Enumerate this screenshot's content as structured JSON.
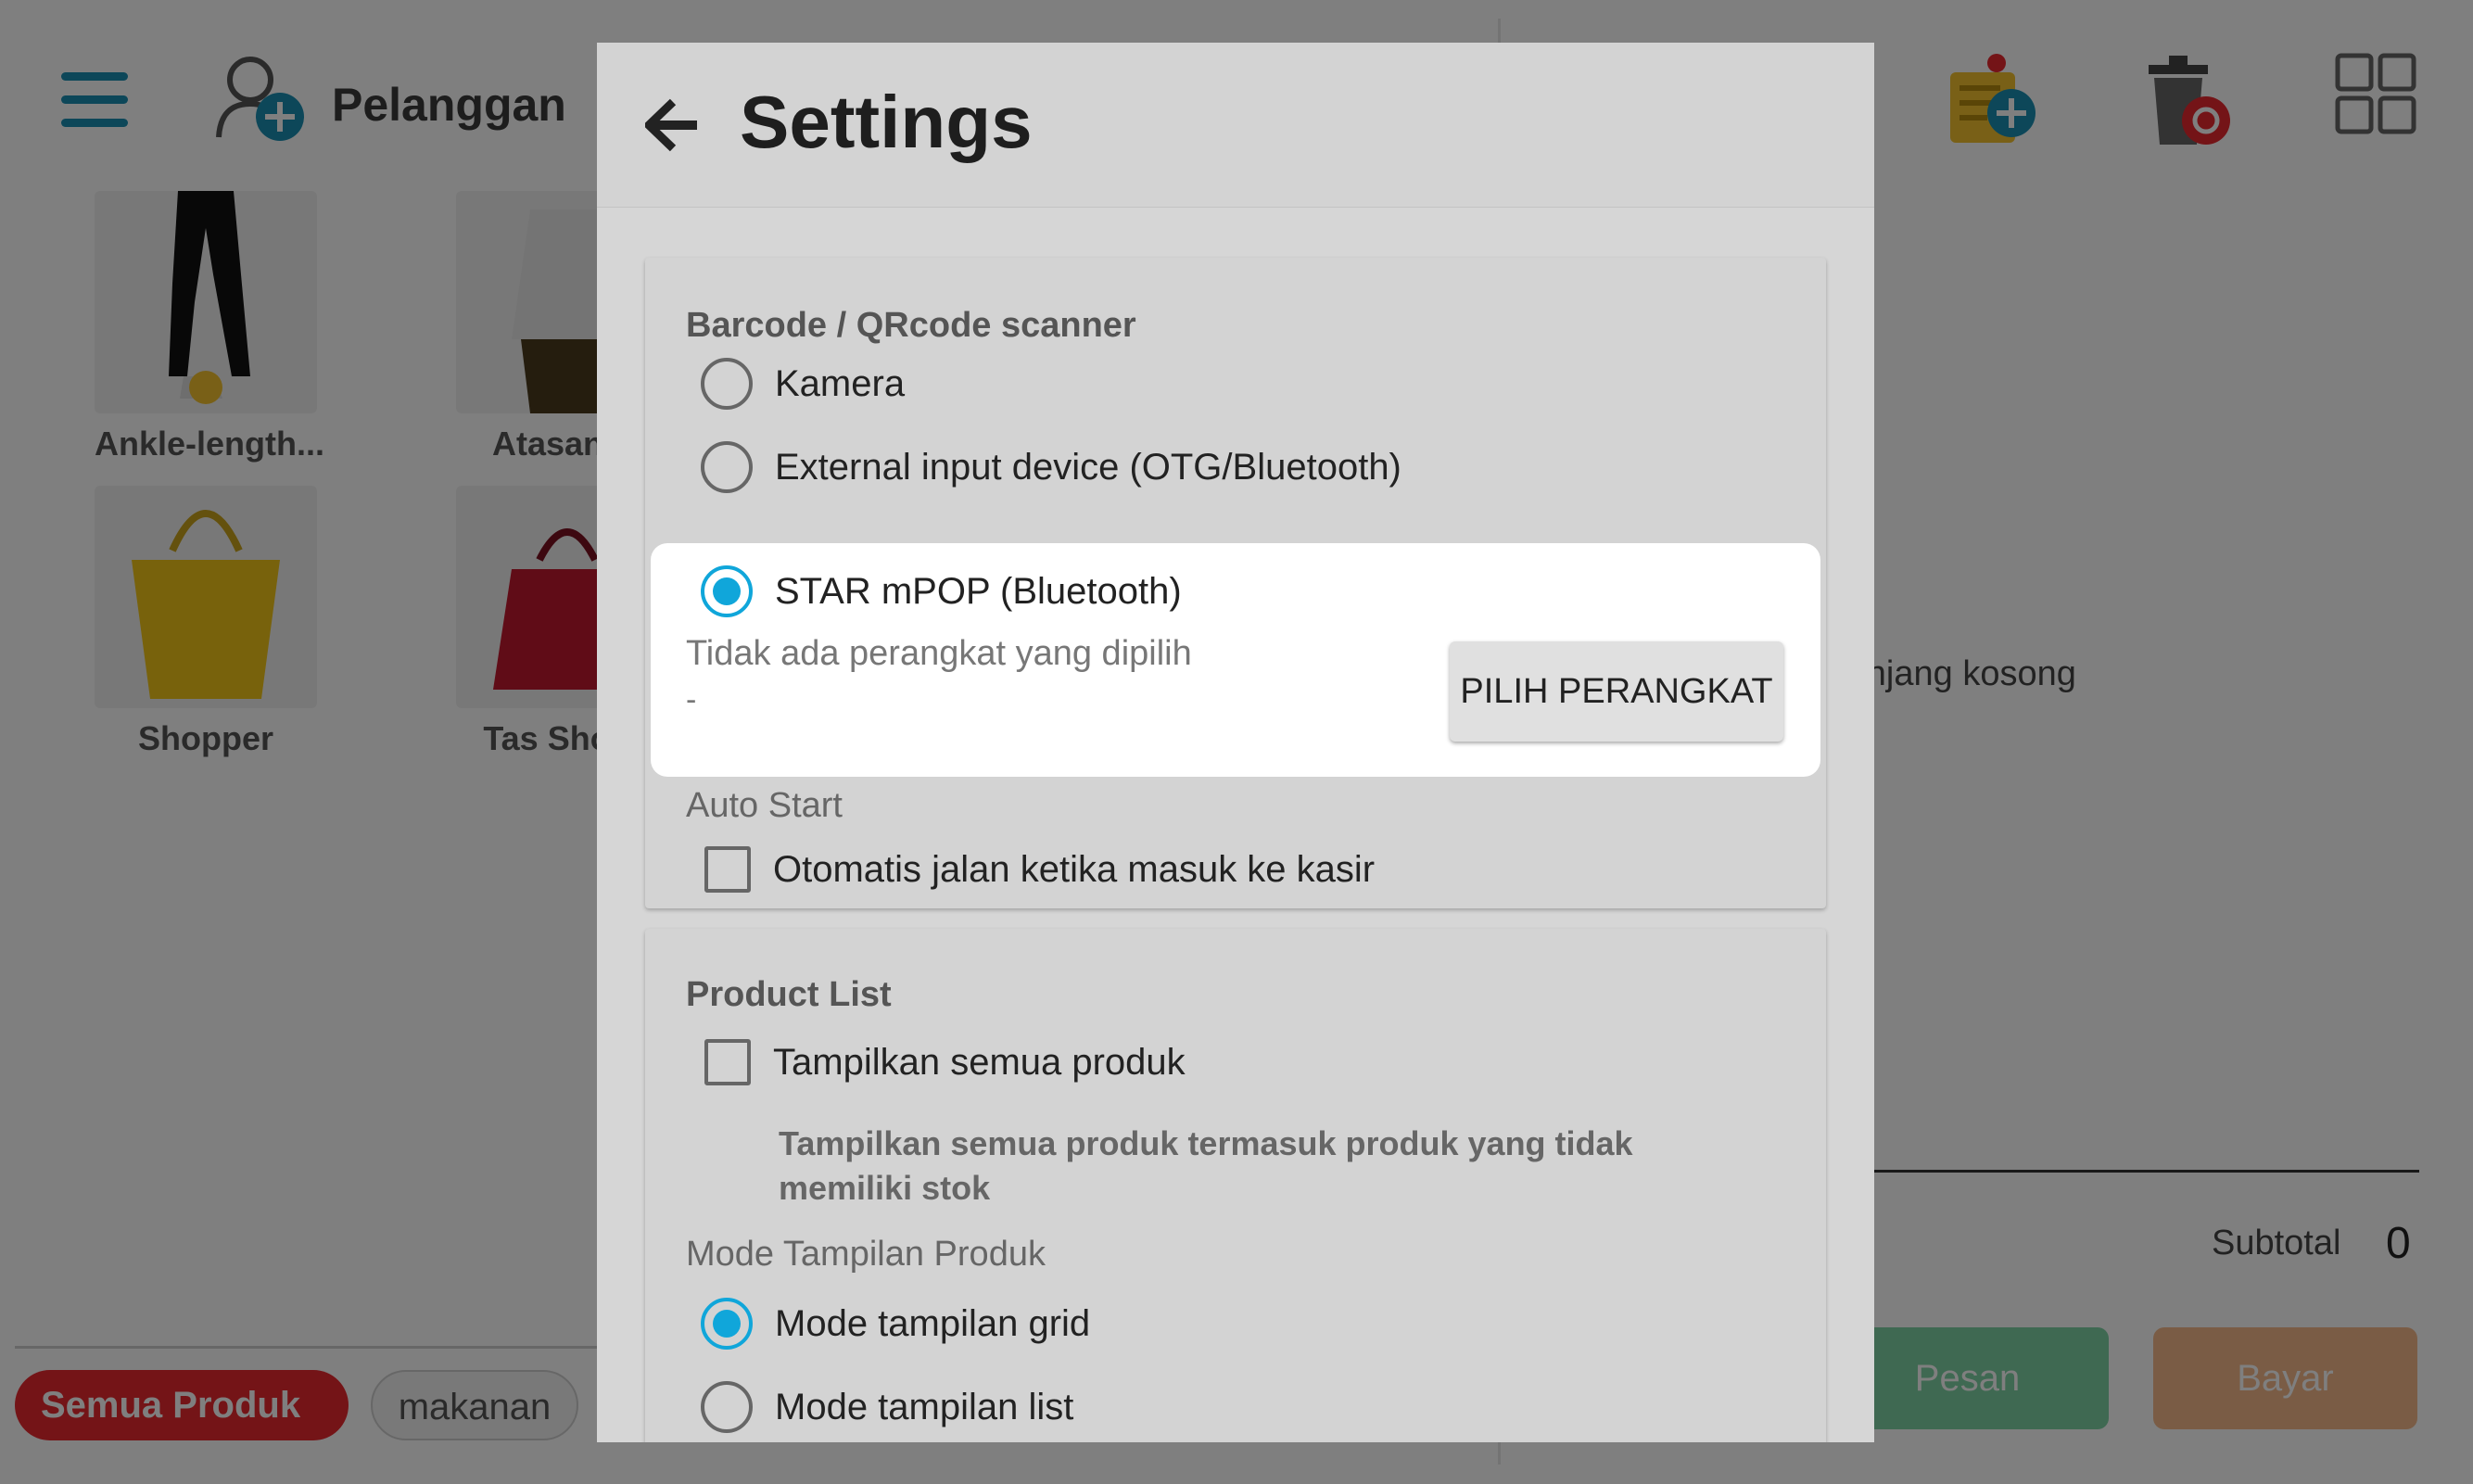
{
  "background": {
    "customer_label": "Pelanggan",
    "products": [
      {
        "name": "Ankle-length..."
      },
      {
        "name": "Atasan Li"
      },
      {
        "name": "Shopper"
      },
      {
        "name": "Tas Shopp"
      }
    ],
    "cart_empty_text": "ranjang kosong",
    "subtotal_label": "Subtotal",
    "subtotal_value": "0",
    "order_button": "Pesan",
    "pay_button": "Bayar",
    "categories": [
      {
        "label": "Semua Produk",
        "active": true
      },
      {
        "label": "makanan",
        "active": false
      }
    ],
    "colors": {
      "brand_blue": "#1a8fb3",
      "category_red": "#e8282f"
    }
  },
  "dialog": {
    "title": "Settings",
    "scanner_section": {
      "title": "Barcode / QRcode scanner",
      "options": [
        {
          "label": "Kamera",
          "selected": false
        },
        {
          "label": "External input device (OTG/Bluetooth)",
          "selected": false
        },
        {
          "label": "STAR mPOP (Bluetooth)",
          "selected": true
        }
      ],
      "device_status": "Tidak ada perangkat yang dipilih",
      "device_value": "-",
      "select_device_button": "PILIH PERANGKAT"
    },
    "auto_start": {
      "title": "Auto Start",
      "checkbox_label": "Otomatis jalan ketika masuk ke kasir",
      "checked": false
    },
    "product_list": {
      "title": "Product List",
      "show_all_label": "Tampilkan semua produk",
      "show_all_checked": false,
      "show_all_description": "Tampilkan semua produk termasuk produk yang tidak memiliki stok",
      "display_mode_title": "Mode Tampilan Produk",
      "display_modes": [
        {
          "label": "Mode tampilan grid",
          "selected": true
        },
        {
          "label": "Mode tampilan list",
          "selected": false
        }
      ]
    },
    "accent_color": "#10a6da"
  }
}
